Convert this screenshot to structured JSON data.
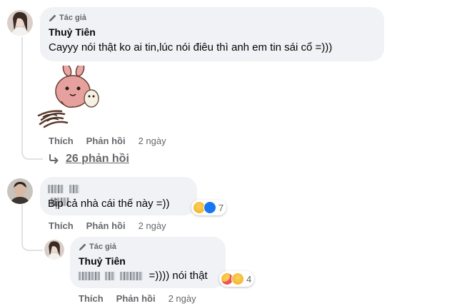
{
  "comment1": {
    "badge": "Tác giả",
    "author": "Thuỷ Tiên",
    "text": "Cayyy nói thật ko ai tin,lúc nói điêu thì anh em tin sái cổ =)))",
    "sticker": "bunny-sticker",
    "actions": {
      "like": "Thích",
      "reply": "Phản hồi",
      "time": "2 ngày"
    },
    "replies_label": "26 phản hồi"
  },
  "comment2": {
    "text": "Bịp cả nhà cái thế này =))",
    "reactions": {
      "icons": [
        "haha",
        "like"
      ],
      "count": "7"
    },
    "actions": {
      "like": "Thích",
      "reply": "Phản hồi",
      "time": "2 ngày"
    }
  },
  "reply1": {
    "badge": "Tác giả",
    "author": "Thuỷ Tiên",
    "text_suffix": "=)))) nói thật",
    "reactions": {
      "icons": [
        "care",
        "haha"
      ],
      "count": "4"
    },
    "actions": {
      "like": "Thích",
      "reply": "Phản hồi",
      "time": "2 ngày"
    }
  },
  "colors": {
    "bubble_bg": "#f0f2f5",
    "secondary_text": "#65676b",
    "like_blue": "#1877f2",
    "haha_yellow": "#f7b125"
  }
}
